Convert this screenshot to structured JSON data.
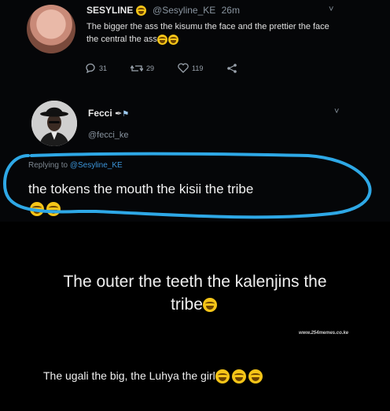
{
  "tweet1": {
    "name": "SESYLINE",
    "handle": "@Sesyline_KE",
    "time": "26m",
    "text": "The bigger the ass the kisumu the face and the prettier the face the central the ass",
    "replies": "31",
    "retweets": "29",
    "likes": "119"
  },
  "tweet2": {
    "name": "Fecci",
    "handle": "@fecci_ke",
    "replying_prefix": "Replying to",
    "replying_handle": "@Sesyline_KE",
    "text": "the tokens the mouth the kisii the tribe"
  },
  "caption1": {
    "line1": "The outer the teeth  the kalenjins the",
    "line2": "tribe"
  },
  "watermark": "www.254memes.co.ke",
  "caption2": "The ugali the big, the Luhya the girl",
  "colors": {
    "scribble": "#2ea8e6",
    "emoji": "#f5c518"
  },
  "icons": [
    "reply-icon",
    "retweet-icon",
    "like-icon",
    "share-icon",
    "chevron-down-icon",
    "laughing-emoji-icon"
  ]
}
